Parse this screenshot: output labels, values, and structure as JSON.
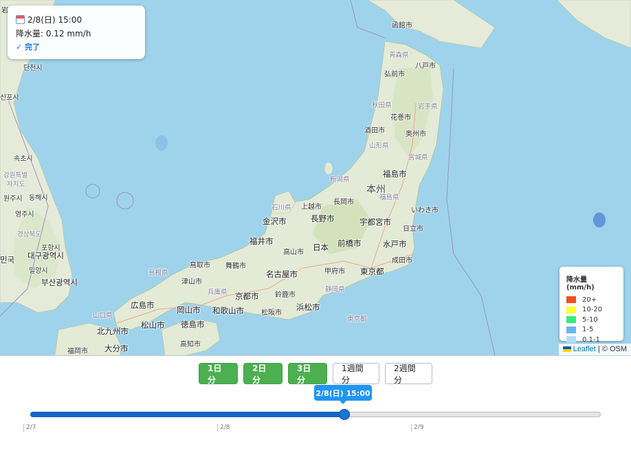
{
  "map": {
    "labels": [
      {
        "t": "岩",
        "k": ""
      },
      {
        "t": "函館市",
        "k": ""
      },
      {
        "t": "青森県",
        "k": "pref"
      },
      {
        "t": "八戸市",
        "k": ""
      },
      {
        "t": "弘前市",
        "k": ""
      },
      {
        "t": "秋田県",
        "k": "pref"
      },
      {
        "t": "岩手県",
        "k": "pref"
      },
      {
        "t": "花巻市",
        "k": ""
      },
      {
        "t": "酒田市",
        "k": ""
      },
      {
        "t": "奥州市",
        "k": ""
      },
      {
        "t": "山形県",
        "k": "pref"
      },
      {
        "t": "宮城県",
        "k": "pref"
      },
      {
        "t": "福島市",
        "k": "big"
      },
      {
        "t": "新潟県",
        "k": "pref"
      },
      {
        "t": "本州",
        "k": "region"
      },
      {
        "t": "福島県",
        "k": "pref"
      },
      {
        "t": "長岡市",
        "k": ""
      },
      {
        "t": "いわき市",
        "k": ""
      },
      {
        "t": "石川県",
        "k": "pref"
      },
      {
        "t": "上越市",
        "k": ""
      },
      {
        "t": "金沢市",
        "k": "big"
      },
      {
        "t": "長野市",
        "k": "big"
      },
      {
        "t": "宇都宮市",
        "k": "big"
      },
      {
        "t": "日立市",
        "k": ""
      },
      {
        "t": "福井市",
        "k": "big"
      },
      {
        "t": "日本",
        "k": "big"
      },
      {
        "t": "前橋市",
        "k": "big"
      },
      {
        "t": "水戸市",
        "k": "big"
      },
      {
        "t": "高山市",
        "k": ""
      },
      {
        "t": "成田市",
        "k": ""
      },
      {
        "t": "鳥取市",
        "k": ""
      },
      {
        "t": "舞鶴市",
        "k": ""
      },
      {
        "t": "甲府市",
        "k": ""
      },
      {
        "t": "島根県",
        "k": "pref"
      },
      {
        "t": "東京都",
        "k": "big"
      },
      {
        "t": "名古屋市",
        "k": "big"
      },
      {
        "t": "津山市",
        "k": ""
      },
      {
        "t": "兵庫県",
        "k": "pref"
      },
      {
        "t": "静岡県",
        "k": "pref"
      },
      {
        "t": "京都市",
        "k": "big"
      },
      {
        "t": "鈴鹿市",
        "k": ""
      },
      {
        "t": "広島市",
        "k": "big"
      },
      {
        "t": "岡山市",
        "k": "big"
      },
      {
        "t": "和歌山市",
        "k": "big"
      },
      {
        "t": "松阪市",
        "k": ""
      },
      {
        "t": "浜松市",
        "k": "big"
      },
      {
        "t": "山口県",
        "k": "pref"
      },
      {
        "t": "東京都",
        "k": "pref"
      },
      {
        "t": "松山市",
        "k": "big"
      },
      {
        "t": "徳島市",
        "k": "big"
      },
      {
        "t": "北九州市",
        "k": "big"
      },
      {
        "t": "高知市",
        "k": ""
      },
      {
        "t": "福岡市",
        "k": ""
      },
      {
        "t": "大分市",
        "k": "big"
      },
      {
        "t": "단천시",
        "k": ""
      },
      {
        "t": "신포시",
        "k": ""
      },
      {
        "t": "속초시",
        "k": ""
      },
      {
        "t": "강원특별",
        "k": "pref"
      },
      {
        "t": "자치도",
        "k": "pref"
      },
      {
        "t": "원주시",
        "k": ""
      },
      {
        "t": "동해시",
        "k": ""
      },
      {
        "t": "영주시",
        "k": ""
      },
      {
        "t": "경상북도",
        "k": "pref"
      },
      {
        "t": "포항시",
        "k": ""
      },
      {
        "t": "대구광역시",
        "k": "big"
      },
      {
        "t": "민국",
        "k": "big"
      },
      {
        "t": "밀양시",
        "k": ""
      },
      {
        "t": "부산광역시",
        "k": "big"
      }
    ]
  },
  "info": {
    "datetime": "2/8(日) 15:00",
    "precip": "降水量: 0.12 mm/h",
    "status": "✓ 完了"
  },
  "legend": {
    "title": "降水量 (mm/h)",
    "items": [
      {
        "label": "20+",
        "color": "#f4511e"
      },
      {
        "label": "10-20",
        "color": "#ffff33"
      },
      {
        "label": "5-10",
        "color": "#33ee77"
      },
      {
        "label": "1-5",
        "color": "#6ab4f5"
      },
      {
        "label": "0.1-1",
        "color": "#b3def7"
      }
    ]
  },
  "attribution": {
    "leaflet": "Leaflet",
    "rest": " | © OSM"
  },
  "controls": {
    "buttons": [
      {
        "label": "1日分",
        "active": true
      },
      {
        "label": "2日分",
        "active": true
      },
      {
        "label": "3日分",
        "active": true
      },
      {
        "label": "1週間分",
        "active": false
      },
      {
        "label": "2週間分",
        "active": false
      }
    ],
    "tooltip": "2/8(日) 15:00",
    "slider_value": 0.55,
    "ticks": [
      "2/7",
      "2/8",
      "2/9"
    ]
  }
}
